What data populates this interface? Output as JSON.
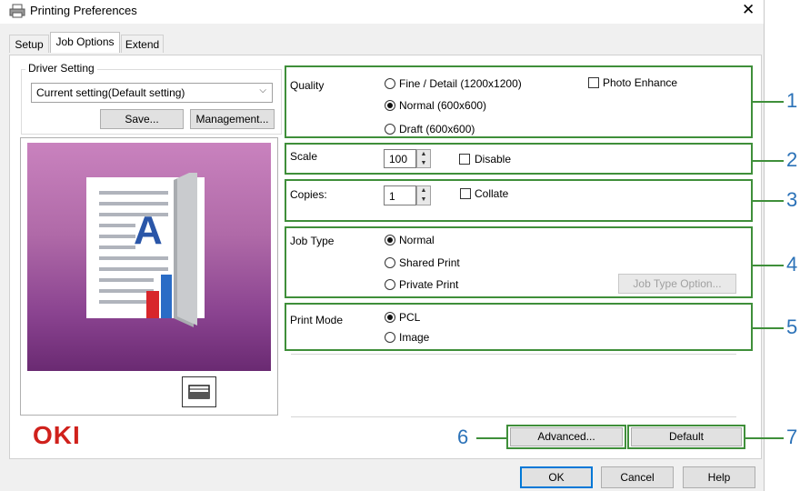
{
  "window": {
    "title": "Printing Preferences",
    "close_glyph": "✕"
  },
  "tabs": [
    {
      "label": "Setup",
      "active": false
    },
    {
      "label": "Job Options",
      "active": true
    },
    {
      "label": "Extend",
      "active": false
    }
  ],
  "driver_setting": {
    "group_label": "Driver Setting",
    "selected": "Current setting(Default setting)",
    "save_label": "Save...",
    "management_label": "Management..."
  },
  "quality": {
    "label": "Quality",
    "options": [
      "Fine / Detail (1200x1200)",
      "Normal (600x600)",
      "Draft (600x600)"
    ],
    "selected_index": 1,
    "photo_enhance_label": "Photo Enhance",
    "photo_enhance_checked": false
  },
  "scale": {
    "label": "Scale",
    "value": "100",
    "disable_label": "Disable",
    "disable_checked": false
  },
  "copies": {
    "label": "Copies:",
    "value": "1",
    "collate_label": "Collate",
    "collate_checked": false
  },
  "job_type": {
    "label": "Job Type",
    "options": [
      "Normal",
      "Shared Print",
      "Private Print"
    ],
    "selected_index": 0,
    "option_button_label": "Job Type Option..."
  },
  "print_mode": {
    "label": "Print Mode",
    "options": [
      "PCL",
      "Image"
    ],
    "selected_index": 0
  },
  "brand": {
    "logo_text": "OKI",
    "color": "#d0211c"
  },
  "bottom": {
    "advanced_label": "Advanced...",
    "default_label": "Default"
  },
  "dialog_buttons": {
    "ok_label": "OK",
    "cancel_label": "Cancel",
    "help_label": "Help"
  },
  "callouts": [
    "1",
    "2",
    "3",
    "4",
    "5",
    "6",
    "7"
  ],
  "colors": {
    "highlight": "#3f8f3a",
    "callout": "#2b72b8",
    "accent": "#0078d7"
  }
}
